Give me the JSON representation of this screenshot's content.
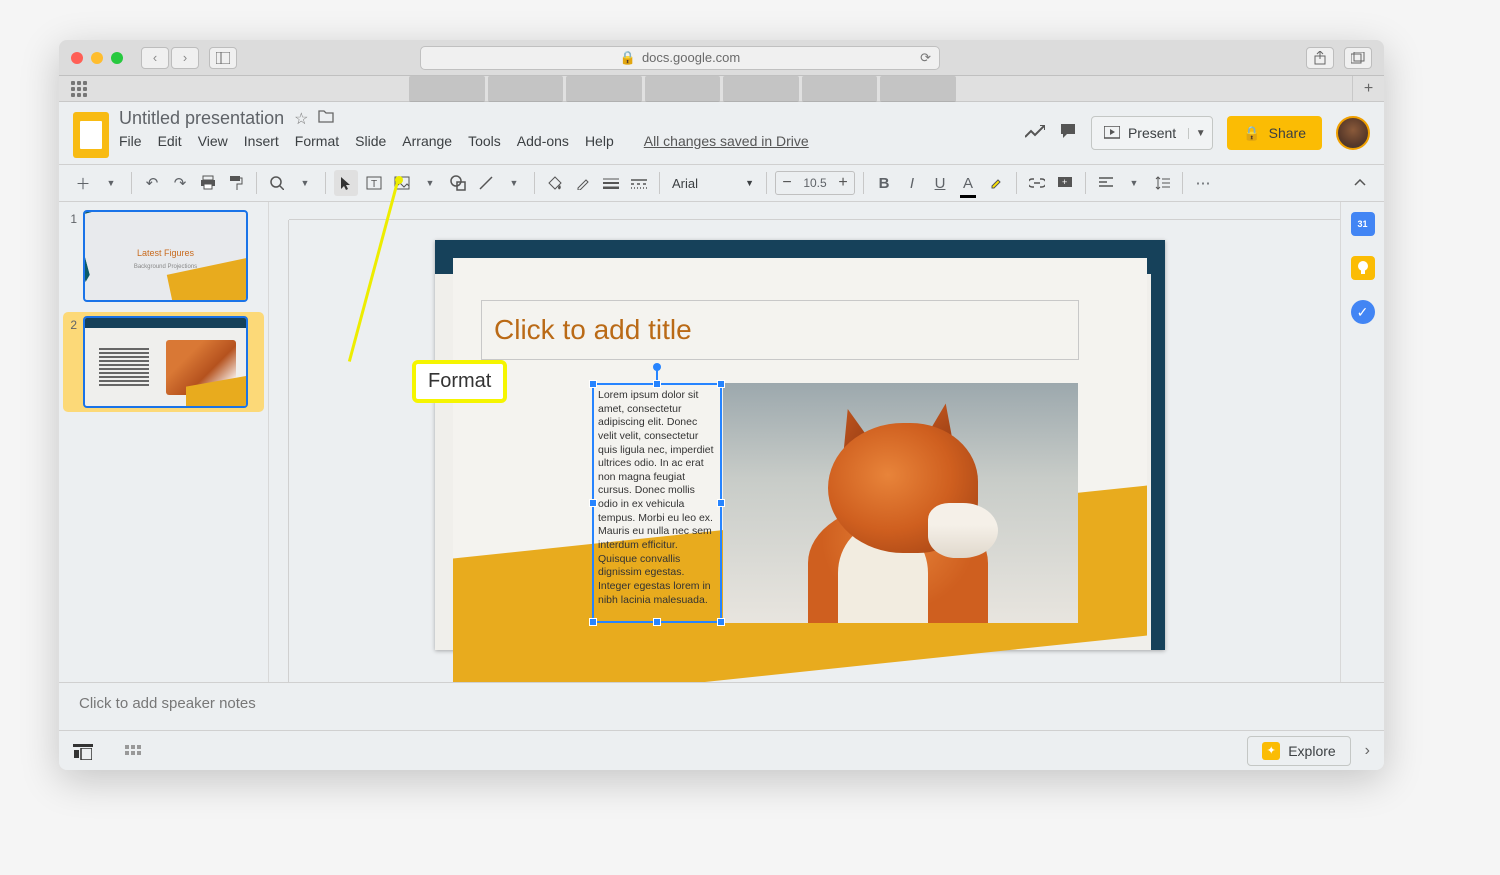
{
  "browser": {
    "url": "docs.google.com"
  },
  "doc": {
    "title": "Untitled presentation",
    "saved_status": "All changes saved in Drive"
  },
  "menus": [
    "File",
    "Edit",
    "View",
    "Insert",
    "Format",
    "Slide",
    "Arrange",
    "Tools",
    "Add-ons",
    "Help"
  ],
  "header_buttons": {
    "present": "Present",
    "share": "Share"
  },
  "toolbar": {
    "font_name": "Arial",
    "font_size": "10.5"
  },
  "thumbs": {
    "slide1_title": "Latest Figures",
    "slide1_sub": "Background Projections",
    "num1": "1",
    "num2": "2"
  },
  "slide": {
    "title_placeholder": "Click to add title",
    "body_text": "Lorem ipsum dolor sit amet, consectetur adipiscing elit. Donec velit velit, consectetur quis ligula nec, imperdiet ultrices odio. In ac erat non magna feugiat cursus. Donec mollis odio in ex vehicula tempus. Morbi eu leo ex. Mauris eu nulla nec sem interdum efficitur. Quisque convallis dignissim egestas. Integer egestas lorem in nibh lacinia malesuada."
  },
  "notes": {
    "placeholder": "Click to add speaker notes"
  },
  "bottom": {
    "explore": "Explore"
  },
  "side_rail": {
    "calendar_day": "31"
  },
  "annotation": {
    "label": "Format"
  }
}
